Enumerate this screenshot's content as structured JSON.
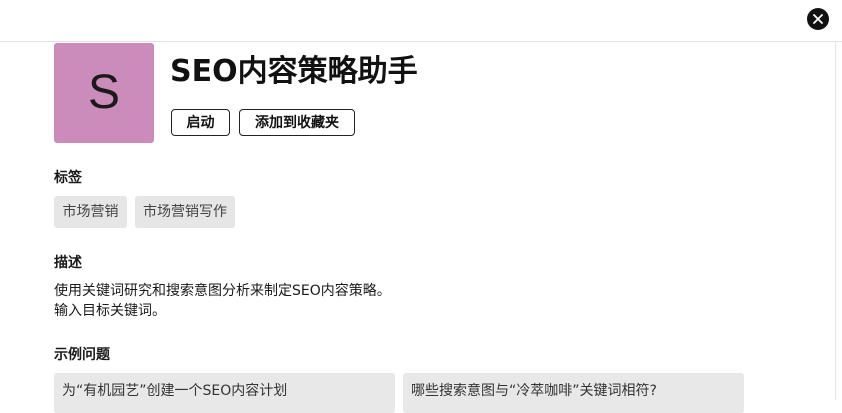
{
  "header": {
    "close_icon": "close-icon"
  },
  "assistant": {
    "avatar_letter": "S",
    "avatar_color": "#cc8cbb",
    "title": "SEO内容策略助手",
    "launch_label": "启动",
    "favorite_label": "添加到收藏夹"
  },
  "tags": {
    "heading": "标签",
    "items": [
      "市场营销",
      "市场营销写作"
    ]
  },
  "description": {
    "heading": "描述",
    "lines": [
      "使用关键词研究和搜索意图分析来制定SEO内容策略。",
      "输入目标关键词。"
    ]
  },
  "examples": {
    "heading": "示例问题",
    "items": [
      "为“有机园艺”创建一个SEO内容计划",
      "哪些搜索意图与“冷萃咖啡”关键词相符?"
    ]
  }
}
